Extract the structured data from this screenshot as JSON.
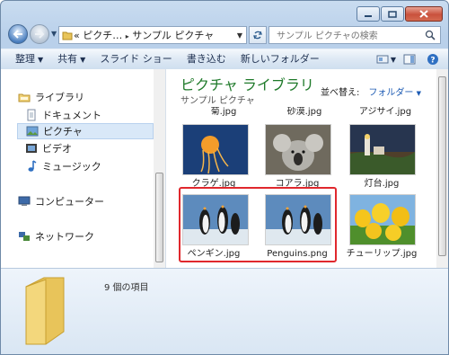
{
  "window": {
    "caption_buttons": [
      "minimize-icon",
      "maximize-icon",
      "close-icon"
    ]
  },
  "address": {
    "chevrons": "«",
    "path": [
      "ピクチ…",
      "サンプル ピクチャ"
    ],
    "separator": "▸"
  },
  "search": {
    "placeholder": "サンプル ピクチャの検索"
  },
  "toolbar": {
    "organize": "整理",
    "share": "共有",
    "slideshow": "スライド ショー",
    "burn": "書き込む",
    "new_folder": "新しいフォルダー"
  },
  "nav": {
    "libraries": "ライブラリ",
    "documents": "ドキュメント",
    "pictures": "ピクチャ",
    "videos": "ビデオ",
    "music": "ミュージック",
    "computer": "コンピューター",
    "network": "ネットワーク"
  },
  "library": {
    "title": "ピクチャ ライブラリ",
    "subtitle": "サンプル ピクチャ",
    "arrange_label": "並べ替え:",
    "arrange_value": "フォルダー"
  },
  "files": {
    "partial": [
      "菊.jpg",
      "砂漠.jpg",
      "アジサイ.jpg"
    ],
    "row1": [
      "クラゲ.jpg",
      "コアラ.jpg",
      "灯台.jpg"
    ],
    "row2": [
      "ペンギン.jpg",
      "Penguins.png",
      "チューリップ.jpg"
    ]
  },
  "status": {
    "count": "9 個の項目"
  },
  "colors": {
    "highlight": "#e0282d",
    "library_title": "#1f7a2a",
    "link": "#1d5bb3"
  }
}
